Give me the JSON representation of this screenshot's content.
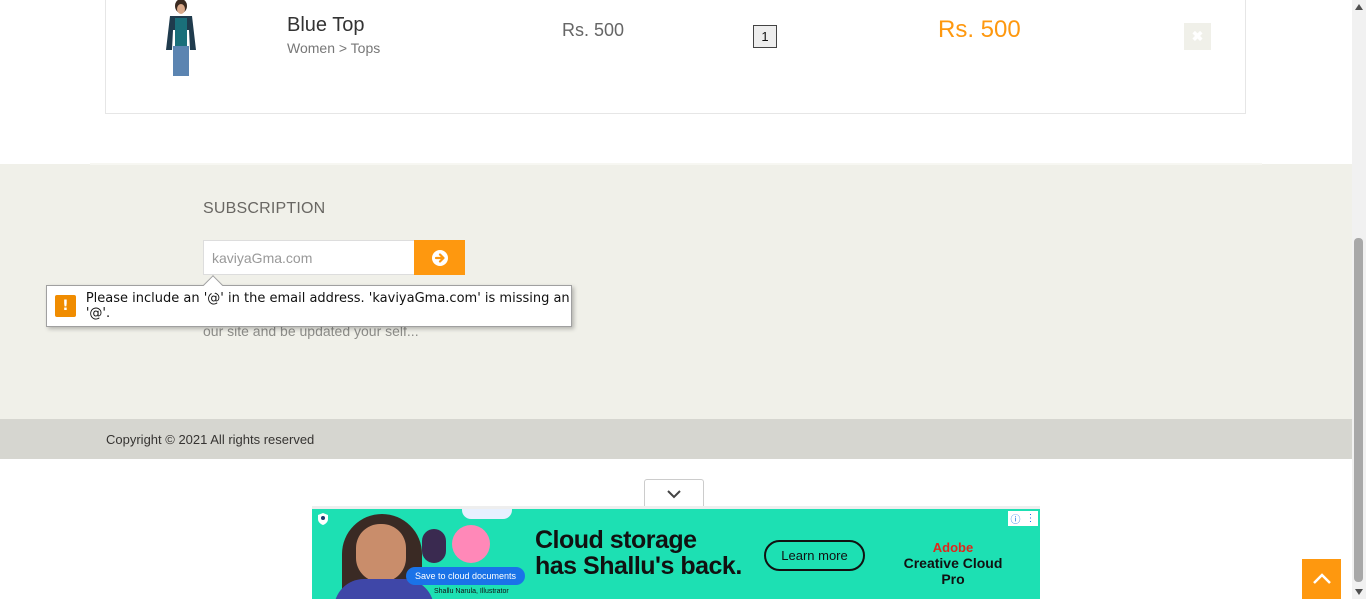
{
  "cart": {
    "product": {
      "name": "Blue Top",
      "category": "Women > Tops",
      "price": "Rs. 500",
      "quantity": "1",
      "total": "Rs. 500",
      "delete_glyph": "✖"
    }
  },
  "subscription": {
    "title": "SUBSCRIPTION",
    "email_value": "kaviyaGma.com",
    "description": "our site and be updated your self..."
  },
  "validation": {
    "message": "Please include an '@' in the email address. 'kaviyaGma.com' is missing an '@'.",
    "icon_glyph": "!"
  },
  "footer": {
    "copyright": "Copyright © 2021 All rights reserved"
  },
  "ad": {
    "headline_line1": "Cloud storage",
    "headline_line2": "has Shallu's back.",
    "cta": "Learn more",
    "brand_line1": "Adobe",
    "brand_line2": "Creative Cloud Pro",
    "pill": "Save to cloud documents",
    "caption": "Shallu Narula, Illustrator"
  },
  "colors": {
    "accent": "#fe980f",
    "footer_bg": "#f0f0e9",
    "footer_bottom_bg": "#d6d6d0",
    "ad_bg": "#1de0b3"
  },
  "icons": {
    "subscribe": "arrow-circle-right-icon",
    "scroll_up": "chevron-up-icon",
    "ad_collapse": "chevron-down-icon"
  }
}
